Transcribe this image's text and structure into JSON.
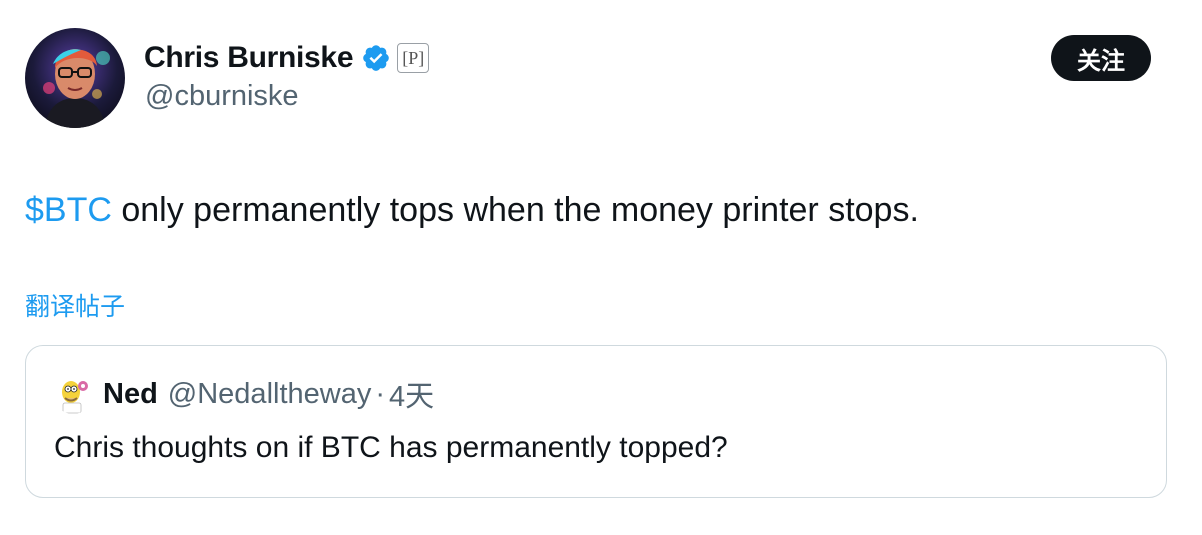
{
  "author": {
    "display_name": "Chris Burniske",
    "handle": "@cburniske",
    "verified_icon": "verified-badge-icon",
    "affiliate_badge": "[P]"
  },
  "follow_button": {
    "label": "关注"
  },
  "tweet": {
    "cashtag": "$BTC",
    "text_rest": " only permanently tops when the money printer stops."
  },
  "translate": {
    "label": "翻译帖子"
  },
  "quote": {
    "name": "Ned",
    "handle": "@Nedalltheway",
    "separator": "·",
    "time": "4天",
    "text": "Chris thoughts on if BTC has permanently topped?"
  },
  "colors": {
    "accent": "#1d9bf0",
    "text_primary": "#0f1419",
    "text_secondary": "#536471",
    "border": "#cfd9de",
    "button_bg": "#0f1419"
  }
}
